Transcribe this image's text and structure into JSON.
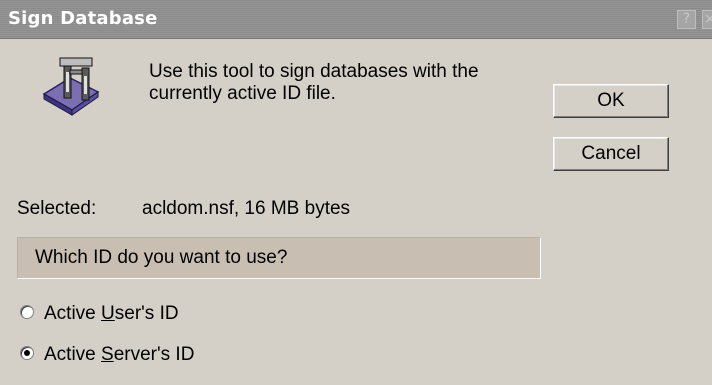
{
  "window": {
    "title": "Sign Database",
    "help_glyph": "?",
    "close_glyph": "×"
  },
  "intro": {
    "text": "Use this tool to sign databases with the currently active ID file.",
    "icon": "sign-tool-icon"
  },
  "buttons": {
    "ok_label": "OK",
    "cancel_label": "Cancel"
  },
  "selected": {
    "label": "Selected:",
    "value": "acldom.nsf, 16 MB bytes"
  },
  "question": {
    "text": "Which ID do you want to use?"
  },
  "options": [
    {
      "prefix": "Active ",
      "accel": "U",
      "suffix": "ser's ID",
      "checked": false
    },
    {
      "prefix": "Active ",
      "accel": "S",
      "suffix": "erver's ID",
      "checked": true
    }
  ],
  "colors": {
    "background": "#d4d0c8",
    "titlebar": "#8f8f8f",
    "question_bar": "#c8bfb2"
  }
}
